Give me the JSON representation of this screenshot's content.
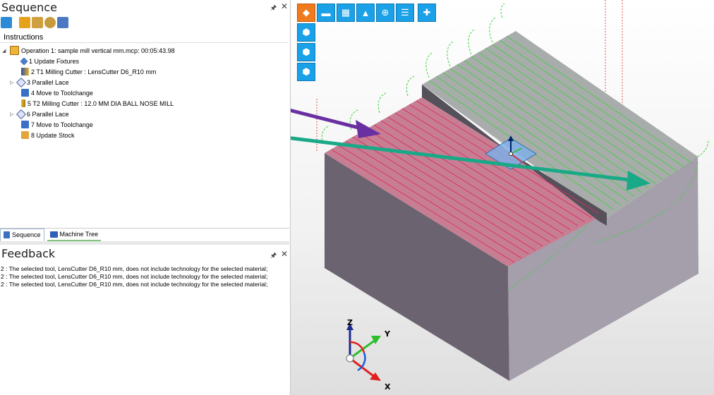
{
  "sequence_panel": {
    "title": "Sequence",
    "pin_icon": "pin-icon",
    "close_icon": "close-icon",
    "instructions_label": "Instructions",
    "items": [
      {
        "text": "Operation 1: sample mill vertical mm.mcp: 00:05:43.98",
        "icon": "nc-operation-icon",
        "expander": "◢"
      },
      {
        "text": "1 Update Fixtures",
        "icon": "fixture-icon"
      },
      {
        "text": "2 T1 Milling Cutter : LensCutter D6_R10 mm",
        "icon": "milling-cutter-icon"
      },
      {
        "text": "3 Parallel Lace",
        "icon": "parallel-lace-icon",
        "expander": "▷"
      },
      {
        "text": "4 Move to Toolchange",
        "icon": "toolchange-icon"
      },
      {
        "text": "5 T2 Milling Cutter : 12.0 MM DIA BALL NOSE MILL",
        "icon": "ball-nose-icon"
      },
      {
        "text": "6 Parallel Lace",
        "icon": "parallel-lace-icon",
        "expander": "▷"
      },
      {
        "text": "7 Move to Toolchange",
        "icon": "toolchange-icon"
      },
      {
        "text": "8 Update Stock",
        "icon": "update-stock-icon"
      }
    ],
    "tabs": [
      {
        "label": "Sequence",
        "active": true
      },
      {
        "label": "Machine Tree",
        "active": false
      }
    ]
  },
  "feedback_panel": {
    "title": "Feedback",
    "lines": [
      "2 : The selected tool, LensCutter D6_R10 mm, does not include technology for the selected material;",
      "2 : The selected tool, LensCutter D6_R10 mm, does not include technology for the selected material;",
      "2 : The selected tool, LensCutter D6_R10 mm, does not include technology for the selected material;"
    ]
  },
  "viewport": {
    "toolbar_icons": [
      "stock-cube-icon",
      "machine-icon",
      "machine-tree-icon",
      "bell-icon",
      "zoom-icon",
      "list-icon",
      "grid-icon"
    ],
    "view_icons": [
      "view-front-icon",
      "view-side-icon",
      "view-iso-icon"
    ],
    "axis_labels": {
      "x": "X",
      "y": "Y",
      "z": "Z"
    },
    "colors": {
      "toolpath_pass1": "#e0245e",
      "toolpath_pass2": "#3ecf3e",
      "arrow1": "#6a2fa0",
      "arrow2": "#19a987",
      "stock_top": "#c77e93",
      "stock_side": "#6b6370"
    }
  }
}
